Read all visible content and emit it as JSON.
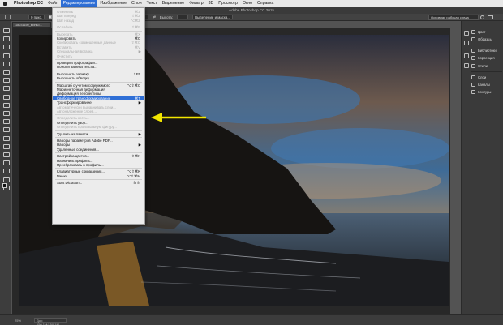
{
  "menubar": {
    "app": "Photoshop CC",
    "items": [
      "Файл",
      "Редактирование",
      "Изображение",
      "Слои",
      "Текст",
      "Выделение",
      "Фильтр",
      "3D",
      "Просмотр",
      "Окно",
      "Справка"
    ],
    "active_index": 1
  },
  "window": {
    "title": "Adobe Photoshop CC 2015"
  },
  "options": {
    "value1": "0 пикс.",
    "label1": "Сгладить",
    "label2": "Стиль:",
    "style_value": "Обычный",
    "label3": "Ширина:",
    "label4": "Высота:",
    "select_btn": "Выделение и маска...",
    "workspace": "Основная рабочая среда"
  },
  "document": {
    "tab": "18031150_миньо...",
    "zoom": "25%",
    "info": "Док: 150,1M/150,1M"
  },
  "dock": {
    "panels": [
      "Цвет",
      "Образцы",
      "Библиотеки",
      "Коррекция",
      "Стили",
      "Слои",
      "Каналы",
      "Контуры"
    ]
  },
  "edit_menu": {
    "items": [
      {
        "label": "Отменить",
        "shortcut": "⌘Z",
        "disabled": true
      },
      {
        "label": "Шаг вперед",
        "shortcut": "⇧⌘Z",
        "disabled": true
      },
      {
        "label": "Шаг назад",
        "shortcut": "⌥⌘Z",
        "disabled": true
      },
      {
        "sep": true
      },
      {
        "label": "Ослабить...",
        "shortcut": "⇧⌘F",
        "disabled": true
      },
      {
        "sep": true
      },
      {
        "label": "Вырезать",
        "shortcut": "⌘X",
        "disabled": true
      },
      {
        "label": "Копировать",
        "shortcut": "⌘C",
        "disabled": false
      },
      {
        "label": "Скопировать совмещенные данные",
        "shortcut": "⇧⌘C",
        "disabled": true
      },
      {
        "label": "Вставить",
        "shortcut": "⌘V",
        "disabled": true
      },
      {
        "label": "Специальная вставка",
        "shortcut": "",
        "disabled": true,
        "submenu": true
      },
      {
        "label": "Очистить",
        "shortcut": "",
        "disabled": true
      },
      {
        "sep": true
      },
      {
        "label": "Проверка орфографии...",
        "shortcut": "",
        "disabled": false
      },
      {
        "label": "Поиск и замена текста...",
        "shortcut": "",
        "disabled": false
      },
      {
        "sep": true
      },
      {
        "label": "Выполнить заливку...",
        "shortcut": "⇧F5",
        "disabled": false
      },
      {
        "label": "Выполнить обводку...",
        "shortcut": "",
        "disabled": false
      },
      {
        "sep": true
      },
      {
        "label": "Масштаб с учетом содержимого",
        "shortcut": "⌥⇧⌘C",
        "disabled": false
      },
      {
        "label": "Марионеточная деформация",
        "shortcut": "",
        "disabled": false
      },
      {
        "label": "Деформация перспективы",
        "shortcut": "",
        "disabled": false
      },
      {
        "label": "Свободное трансформирование",
        "shortcut": "⌘T",
        "disabled": false,
        "highlight": true
      },
      {
        "label": "Трансформирование",
        "shortcut": "",
        "disabled": false,
        "submenu": true
      },
      {
        "label": "Автоматически выравнивать слои...",
        "shortcut": "",
        "disabled": true
      },
      {
        "label": "Автоналожение слоев...",
        "shortcut": "",
        "disabled": true
      },
      {
        "sep": true
      },
      {
        "label": "Определить кисть...",
        "shortcut": "",
        "disabled": true
      },
      {
        "label": "Определить узор...",
        "shortcut": "",
        "disabled": false
      },
      {
        "label": "Определить произвольную фигуру...",
        "shortcut": "",
        "disabled": true
      },
      {
        "sep": true
      },
      {
        "label": "Удалить из памяти",
        "shortcut": "",
        "disabled": false,
        "submenu": true
      },
      {
        "sep": true
      },
      {
        "label": "Наборы параметров Adobe PDF...",
        "shortcut": "",
        "disabled": false
      },
      {
        "label": "Наборы",
        "shortcut": "",
        "disabled": false,
        "submenu": true
      },
      {
        "label": "Удаленные соединения...",
        "shortcut": "",
        "disabled": false
      },
      {
        "sep": true
      },
      {
        "label": "Настройка цветов...",
        "shortcut": "⇧⌘K",
        "disabled": false
      },
      {
        "label": "Назначить профиль...",
        "shortcut": "",
        "disabled": false
      },
      {
        "label": "Преобразовать в профиль...",
        "shortcut": "",
        "disabled": false
      },
      {
        "sep": true
      },
      {
        "label": "Клавиатурные сокращения...",
        "shortcut": "⌥⇧⌘K",
        "disabled": false
      },
      {
        "label": "Меню...",
        "shortcut": "⌥⇧⌘M",
        "disabled": false
      },
      {
        "sep": true
      },
      {
        "label": "Start Dictation...",
        "shortcut": "fn fn",
        "disabled": false
      }
    ]
  },
  "colors": {
    "highlight": "#2f6fd6",
    "arrow": "#f2e600",
    "foreground": "#111111",
    "background": "#d21b1b"
  }
}
